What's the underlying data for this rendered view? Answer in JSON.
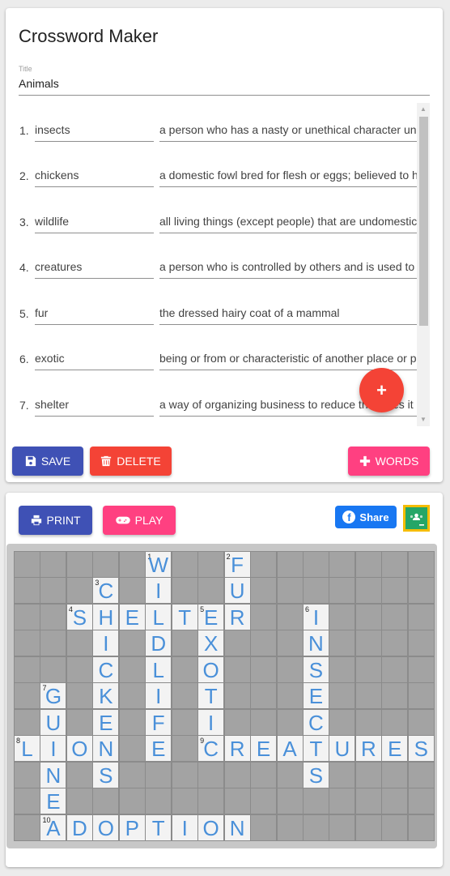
{
  "app": {
    "title": "Crossword Maker"
  },
  "title_field": {
    "label": "Title",
    "value": "Animals"
  },
  "words": [
    {
      "num": "1.",
      "word": "insects",
      "clue": "a person who has a nasty or unethical character undeserving of respect"
    },
    {
      "num": "2.",
      "word": "chickens",
      "clue": "a domestic fowl bred for flesh or eggs; believed to have been developed from the red jungle fowl"
    },
    {
      "num": "3.",
      "word": "wildlife",
      "clue": "all living things (except people) that are undomesticated"
    },
    {
      "num": "4.",
      "word": "creatures",
      "clue": "a person who is controlled by others and is used to perform unpleasant or dishonest tasks for someone else"
    },
    {
      "num": "5.",
      "word": "fur",
      "clue": "the dressed hairy coat of a mammal"
    },
    {
      "num": "6.",
      "word": "exotic",
      "clue": "being or from or characteristic of another place or part of the world"
    },
    {
      "num": "7.",
      "word": "shelter",
      "clue": "a way of organizing business to reduce the taxes it must pay"
    }
  ],
  "buttons": {
    "fab": "+",
    "save": "SAVE",
    "delete": "DELETE",
    "words": "WORDS",
    "print": "PRINT",
    "play": "PLAY",
    "share": "Share"
  },
  "icons": {
    "save": "floppy-disk-icon",
    "delete": "trash-icon",
    "words": "plus-icon",
    "print": "printer-icon",
    "play": "gamepad-icon",
    "share": "facebook-icon",
    "classroom": "google-classroom-icon"
  },
  "colors": {
    "primary": "#3f51b5",
    "danger": "#f44336",
    "accent": "#ff4081",
    "facebook": "#1877f2",
    "classroom": "#25a667",
    "letter": "#4a90d9"
  },
  "crossword": {
    "cols": 16,
    "rows": 11,
    "entries": [
      {
        "number": 1,
        "answer": "WILDLIFE",
        "row": 0,
        "col": 5,
        "dir": "down"
      },
      {
        "number": 2,
        "answer": "FUR",
        "row": 0,
        "col": 8,
        "dir": "down"
      },
      {
        "number": 3,
        "answer": "CHICKENS",
        "row": 1,
        "col": 3,
        "dir": "down"
      },
      {
        "number": 4,
        "answer": "SHELTER",
        "row": 2,
        "col": 2,
        "dir": "across"
      },
      {
        "number": 5,
        "answer": "EXOTIC",
        "row": 2,
        "col": 7,
        "dir": "down"
      },
      {
        "number": 6,
        "answer": "INSECTS",
        "row": 2,
        "col": 11,
        "dir": "down"
      },
      {
        "number": 7,
        "answer": "GUINEA",
        "row": 5,
        "col": 1,
        "dir": "down"
      },
      {
        "number": 8,
        "answer": "LION",
        "row": 7,
        "col": 0,
        "dir": "across"
      },
      {
        "number": 9,
        "answer": "CREATURES",
        "row": 7,
        "col": 7,
        "dir": "across"
      },
      {
        "number": 10,
        "answer": "ADOPTION",
        "row": 10,
        "col": 1,
        "dir": "across"
      }
    ]
  }
}
